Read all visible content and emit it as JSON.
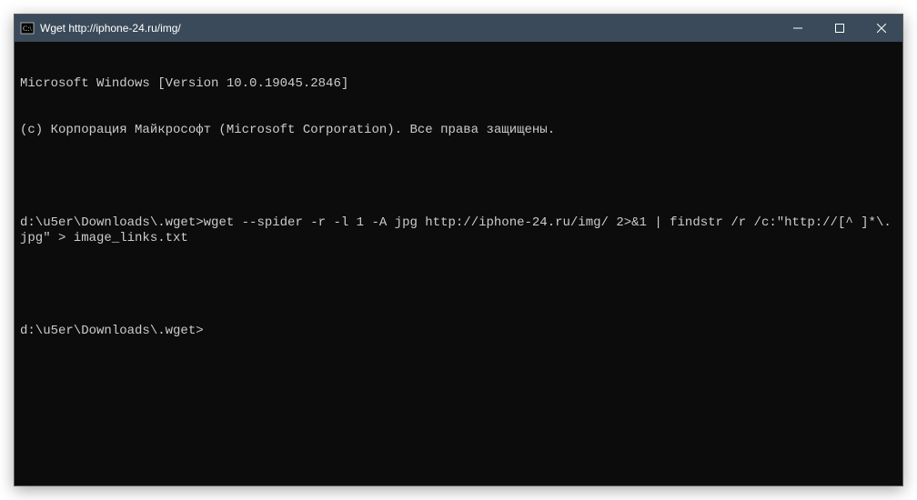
{
  "window": {
    "title": "Wget http://iphone-24.ru/img/"
  },
  "terminal": {
    "line1": "Microsoft Windows [Version 10.0.19045.2846]",
    "line2": "(c) Корпорация Майкрософт (Microsoft Corporation). Все права защищены.",
    "prompt1_path": "d:\\u5er\\Downloads\\.wget>",
    "command1": "wget --spider -r -l 1 -A jpg http://iphone-24.ru/img/ 2>&1 | findstr /r /c:\"http://[^ ]*\\.jpg\" > image_links.txt",
    "prompt2_path": "d:\\u5er\\Downloads\\.wget>"
  }
}
